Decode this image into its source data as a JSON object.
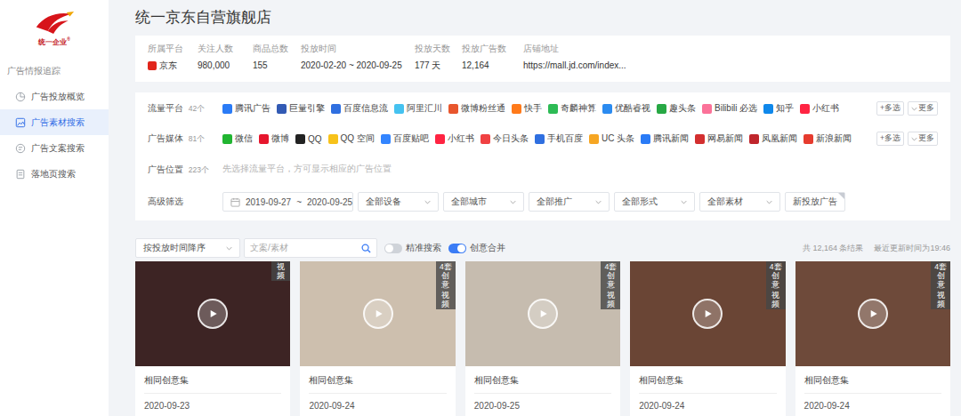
{
  "sidebar": {
    "logo": {
      "text": "统一企业",
      "mark": "®"
    },
    "section": "广告情报追踪",
    "items": [
      {
        "label": "广告投放概览",
        "selected": false
      },
      {
        "label": "广告素材搜索",
        "selected": true
      },
      {
        "label": "广告文案搜索",
        "selected": false
      },
      {
        "label": "落地页搜索",
        "selected": false
      }
    ]
  },
  "header": {
    "title": "统一京东自营旗舰店"
  },
  "info": [
    {
      "label": "所属平台",
      "value": "京东",
      "kind": "platform"
    },
    {
      "label": "关注人数",
      "value": "980,000",
      "kind": "text"
    },
    {
      "label": "商品总数",
      "value": "155",
      "kind": "text"
    },
    {
      "label": "投放时间",
      "value": "2020-02-20 ~ 2020-09-25",
      "kind": "text"
    },
    {
      "label": "投放天数",
      "value": "177 天",
      "kind": "text"
    },
    {
      "label": "投放广告数",
      "value": "12,164",
      "kind": "text"
    },
    {
      "label": "店铺地址",
      "value": "https://mall.jd.com/index...",
      "kind": "text"
    }
  ],
  "filters": {
    "platforms": {
      "label": "流量平台",
      "count": "42个",
      "items": [
        {
          "label": "腾讯广告",
          "color": "#2a7bf6"
        },
        {
          "label": "巨量引擎",
          "color": "#325ab4"
        },
        {
          "label": "百度信息流",
          "color": "#2f6fe0"
        },
        {
          "label": "阿里汇川",
          "color": "#45c2f0"
        },
        {
          "label": "微博粉丝通",
          "color": "#e8562d"
        },
        {
          "label": "快手",
          "color": "#ff7a1a"
        },
        {
          "label": "奇麟神算",
          "color": "#2dbb55"
        },
        {
          "label": "优酷睿视",
          "color": "#2b8bf0"
        },
        {
          "label": "趣头条",
          "color": "#27a844"
        },
        {
          "label": "Bilibili 必选",
          "color": "#fb7299"
        },
        {
          "label": "知乎",
          "color": "#0f88eb"
        },
        {
          "label": "小红书",
          "color": "#ff2442"
        }
      ],
      "buttons": [
        {
          "label": "+多选",
          "kind": "plain"
        },
        {
          "label": "更多",
          "kind": "dropdown"
        }
      ]
    },
    "media": {
      "label": "广告媒体",
      "count": "81个",
      "items": [
        {
          "label": "微信",
          "color": "#21b531"
        },
        {
          "label": "微博",
          "color": "#e6162d"
        },
        {
          "label": "QQ",
          "color": "#222222"
        },
        {
          "label": "QQ 空间",
          "color": "#f7c21a"
        },
        {
          "label": "百度贴吧",
          "color": "#3385ff"
        },
        {
          "label": "小红书",
          "color": "#ff2442"
        },
        {
          "label": "今日头条",
          "color": "#f04142"
        },
        {
          "label": "手机百度",
          "color": "#2f6fe0"
        },
        {
          "label": "UC 头条",
          "color": "#f6a623"
        },
        {
          "label": "腾讯新闻",
          "color": "#2a7bf6"
        },
        {
          "label": "网易新闻",
          "color": "#d32f2f"
        },
        {
          "label": "凤凰新闻",
          "color": "#c0262c"
        },
        {
          "label": "新浪新闻",
          "color": "#e63b2e"
        }
      ],
      "buttons": [
        {
          "label": "+多选",
          "kind": "plain"
        },
        {
          "label": "更多",
          "kind": "dropdown"
        }
      ]
    },
    "position": {
      "label": "广告位置",
      "count": "223个",
      "hint": "先选择流量平台，方可显示相应的广告位置"
    },
    "advanced": {
      "label": "高级筛选",
      "date": {
        "start": "2019-09-27",
        "sep": "~",
        "end": "2020-09-25"
      },
      "selects": [
        "全部设备",
        "全部城市",
        "全部推广",
        "全部形式",
        "全部素材"
      ],
      "tag": {
        "label": "新投放广告",
        "selected": false
      }
    }
  },
  "toolbar": {
    "sort": "按投放时间降序",
    "search": {
      "placeholder": "文案/素材"
    },
    "toggles": [
      {
        "label": "精准搜索",
        "on": false
      },
      {
        "label": "创意合并",
        "on": true
      }
    ],
    "total": "共 12,164 条结果",
    "updated": "最近更新时间为19:46"
  },
  "cards": [
    {
      "badges": [
        "视频"
      ],
      "title": "相同创意集",
      "date": "2020-09-23",
      "color": "#3d2424"
    },
    {
      "badges": [
        "4套创意",
        "视频"
      ],
      "title": "相同创意集",
      "date": "2020-09-24",
      "color": "#cdbfae"
    },
    {
      "badges": [
        "4套创意",
        "视频"
      ],
      "title": "相同创意集",
      "date": "2020-09-25",
      "color": "#c6bcaf"
    },
    {
      "badges": [
        "4套创意",
        "视频"
      ],
      "title": "相同创意集",
      "date": "2020-09-24",
      "color": "#6a4535"
    },
    {
      "badges": [
        "4套创意",
        "视频"
      ],
      "title": "相同创意集",
      "date": "2020-09-24",
      "color": "#6e4a3a"
    }
  ]
}
